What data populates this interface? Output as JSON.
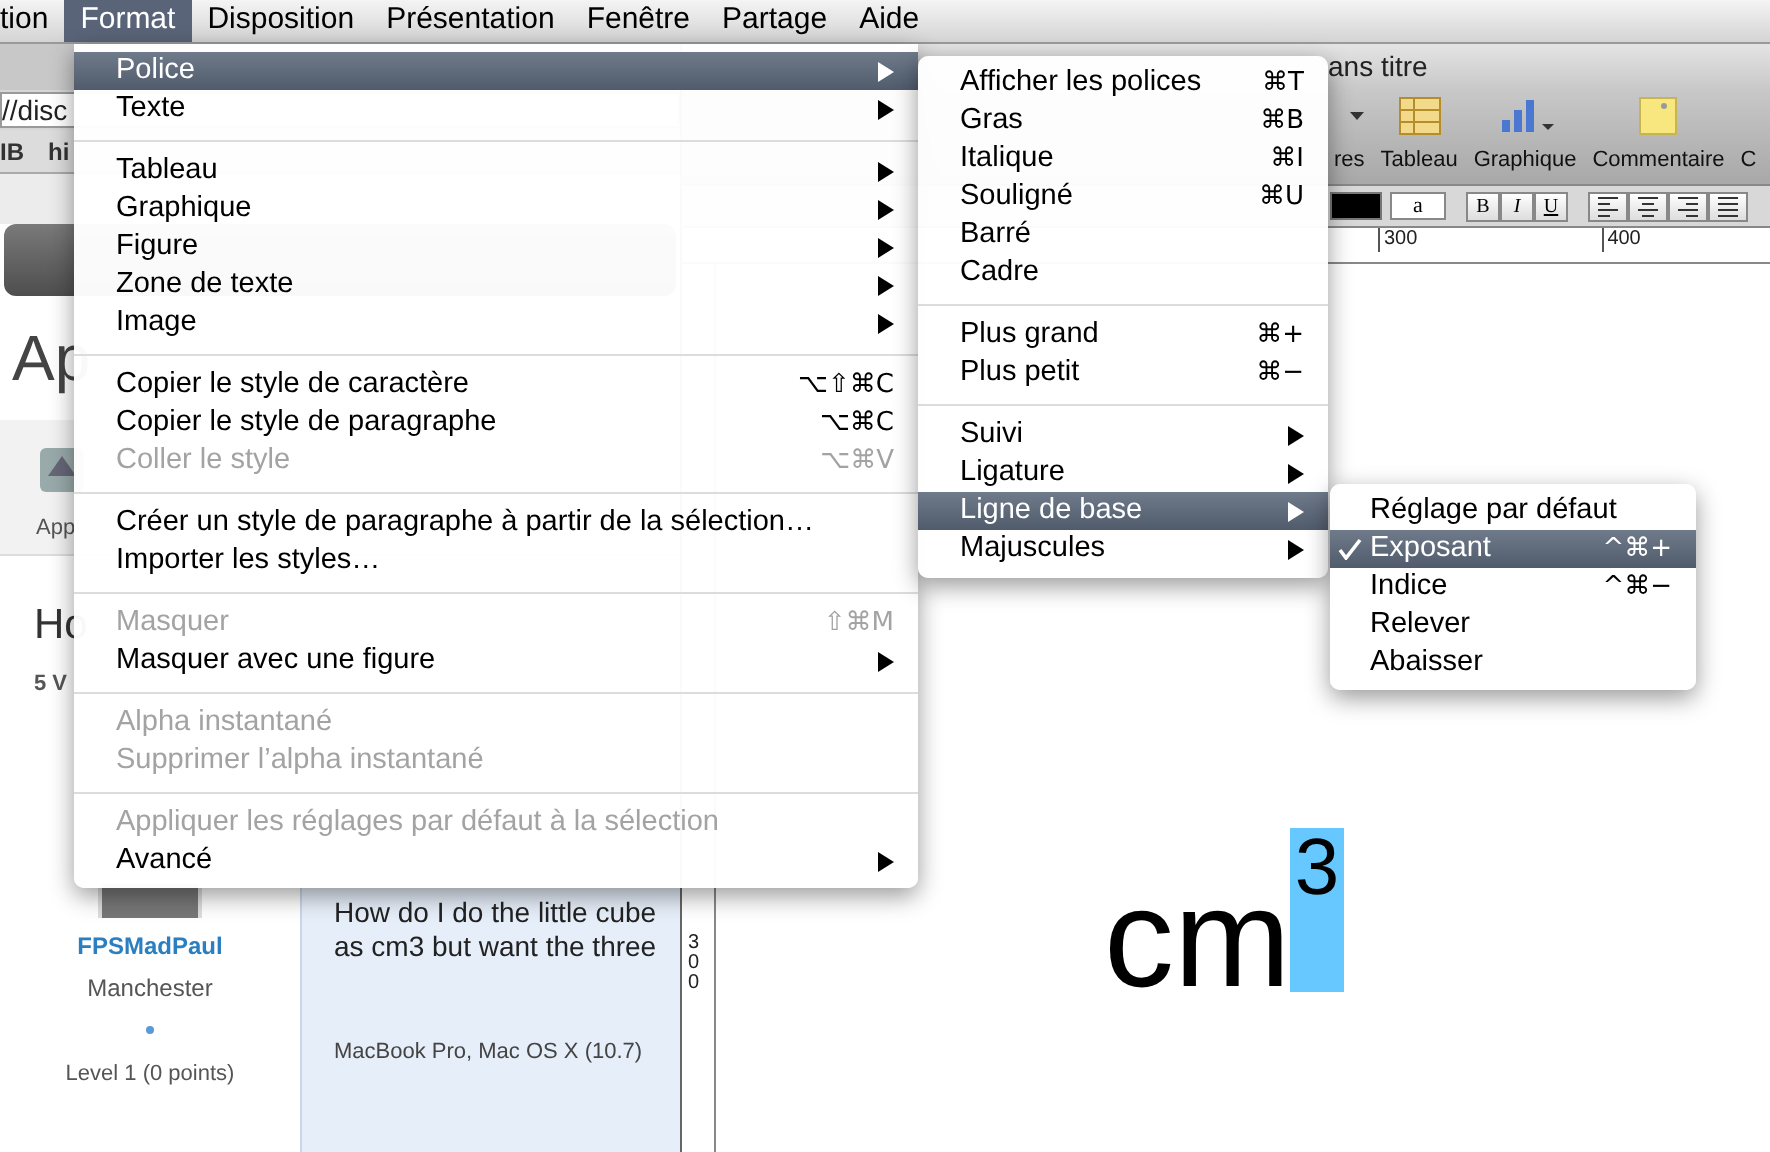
{
  "menu_bar": {
    "items": [
      {
        "label": "tion",
        "selected": false
      },
      {
        "label": "Format",
        "selected": true
      },
      {
        "label": "Disposition",
        "selected": false
      },
      {
        "label": "Présentation",
        "selected": false
      },
      {
        "label": "Fenêtre",
        "selected": false
      },
      {
        "label": "Partage",
        "selected": false
      },
      {
        "label": "Aide",
        "selected": false
      }
    ]
  },
  "format_menu": {
    "sections": [
      [
        {
          "label": "Police",
          "submenu": true,
          "selected": true,
          "disabled": false
        },
        {
          "label": "Texte",
          "submenu": true,
          "selected": false,
          "disabled": false
        }
      ],
      [
        {
          "label": "Tableau",
          "submenu": true,
          "selected": false,
          "disabled": false
        },
        {
          "label": "Graphique",
          "submenu": true,
          "selected": false,
          "disabled": false
        },
        {
          "label": "Figure",
          "submenu": true,
          "selected": false,
          "disabled": false
        },
        {
          "label": "Zone de texte",
          "submenu": true,
          "selected": false,
          "disabled": false
        },
        {
          "label": "Image",
          "submenu": true,
          "selected": false,
          "disabled": false
        }
      ],
      [
        {
          "label": "Copier le style de caractère",
          "shortcut": "⌥⇧⌘C",
          "submenu": false,
          "selected": false,
          "disabled": false
        },
        {
          "label": "Copier le style de paragraphe",
          "shortcut": "⌥⌘C",
          "submenu": false,
          "selected": false,
          "disabled": false
        },
        {
          "label": "Coller le style",
          "shortcut": "⌥⌘V",
          "submenu": false,
          "selected": false,
          "disabled": true
        }
      ],
      [
        {
          "label": "Créer un style de paragraphe à partir de la sélection…",
          "submenu": false,
          "selected": false,
          "disabled": false
        },
        {
          "label": "Importer les styles…",
          "submenu": false,
          "selected": false,
          "disabled": false
        }
      ],
      [
        {
          "label": "Masquer",
          "shortcut": "⇧⌘M",
          "submenu": false,
          "selected": false,
          "disabled": true
        },
        {
          "label": "Masquer avec une figure",
          "submenu": true,
          "selected": false,
          "disabled": false
        }
      ],
      [
        {
          "label": "Alpha instantané",
          "submenu": false,
          "selected": false,
          "disabled": true
        },
        {
          "label": "Supprimer l’alpha instantané",
          "submenu": false,
          "selected": false,
          "disabled": true
        }
      ],
      [
        {
          "label": "Appliquer les réglages par défaut à la sélection",
          "submenu": false,
          "selected": false,
          "disabled": true
        },
        {
          "label": "Avancé",
          "submenu": true,
          "selected": false,
          "disabled": false
        }
      ]
    ]
  },
  "font_submenu": {
    "sections": [
      [
        {
          "label": "Afficher les polices",
          "shortcut": "⌘T",
          "submenu": false,
          "selected": false
        },
        {
          "label": "Gras",
          "shortcut": "⌘B",
          "submenu": false,
          "selected": false
        },
        {
          "label": "Italique",
          "shortcut": "⌘I",
          "submenu": false,
          "selected": false
        },
        {
          "label": "Souligné",
          "shortcut": "⌘U",
          "submenu": false,
          "selected": false
        },
        {
          "label": "Barré",
          "submenu": false,
          "selected": false
        },
        {
          "label": "Cadre",
          "submenu": false,
          "selected": false
        }
      ],
      [
        {
          "label": "Plus grand",
          "shortcut": "⌘+",
          "submenu": false,
          "selected": false
        },
        {
          "label": "Plus petit",
          "shortcut": "⌘−",
          "submenu": false,
          "selected": false
        }
      ],
      [
        {
          "label": "Suivi",
          "submenu": true,
          "selected": false
        },
        {
          "label": "Ligature",
          "submenu": true,
          "selected": false
        },
        {
          "label": "Ligne de base",
          "submenu": true,
          "selected": true
        },
        {
          "label": "Majuscules",
          "submenu": true,
          "selected": false
        }
      ]
    ]
  },
  "baseline_submenu": {
    "items": [
      {
        "label": "Réglage par défaut",
        "checked": false,
        "selected": false
      },
      {
        "label": "Exposant",
        "shortcut": "^⌘+",
        "checked": true,
        "selected": true
      },
      {
        "label": "Indice",
        "shortcut": "^⌘−",
        "checked": false,
        "selected": false
      },
      {
        "label": "Relever",
        "checked": false,
        "selected": false
      },
      {
        "label": "Abaisser",
        "checked": false,
        "selected": false
      }
    ]
  },
  "browser": {
    "url": "//disc",
    "bookmarks": [
      "IB",
      "hi"
    ],
    "heading": "Ap",
    "app_label": "App",
    "question_title": "Ho",
    "views": "5 V",
    "author": {
      "name": "FPSMadPaul",
      "location": "Manchester",
      "level_label": "Level 1 (0 points)"
    },
    "post": {
      "lines": [
        "How do I do the little cube",
        "as cm3 but want the three"
      ],
      "device": "MacBook Pro, Mac OS X (10.7)"
    }
  },
  "pages": {
    "title": "ans titre",
    "toolbar": [
      {
        "label": "res",
        "kind": "partial"
      },
      {
        "label": "Tableau",
        "kind": "table"
      },
      {
        "label": "Graphique",
        "kind": "chart"
      },
      {
        "label": "Commentaire",
        "kind": "comment"
      },
      {
        "label": "C",
        "kind": "partial_end"
      }
    ],
    "swatch_label": "a",
    "style_buttons": [
      "B",
      "I",
      "U"
    ],
    "ruler_labels": [
      "300",
      "400"
    ],
    "vertical_ruler_label": "300",
    "document": {
      "text": "cm",
      "superscript": "3",
      "superscript_selected": true
    }
  }
}
